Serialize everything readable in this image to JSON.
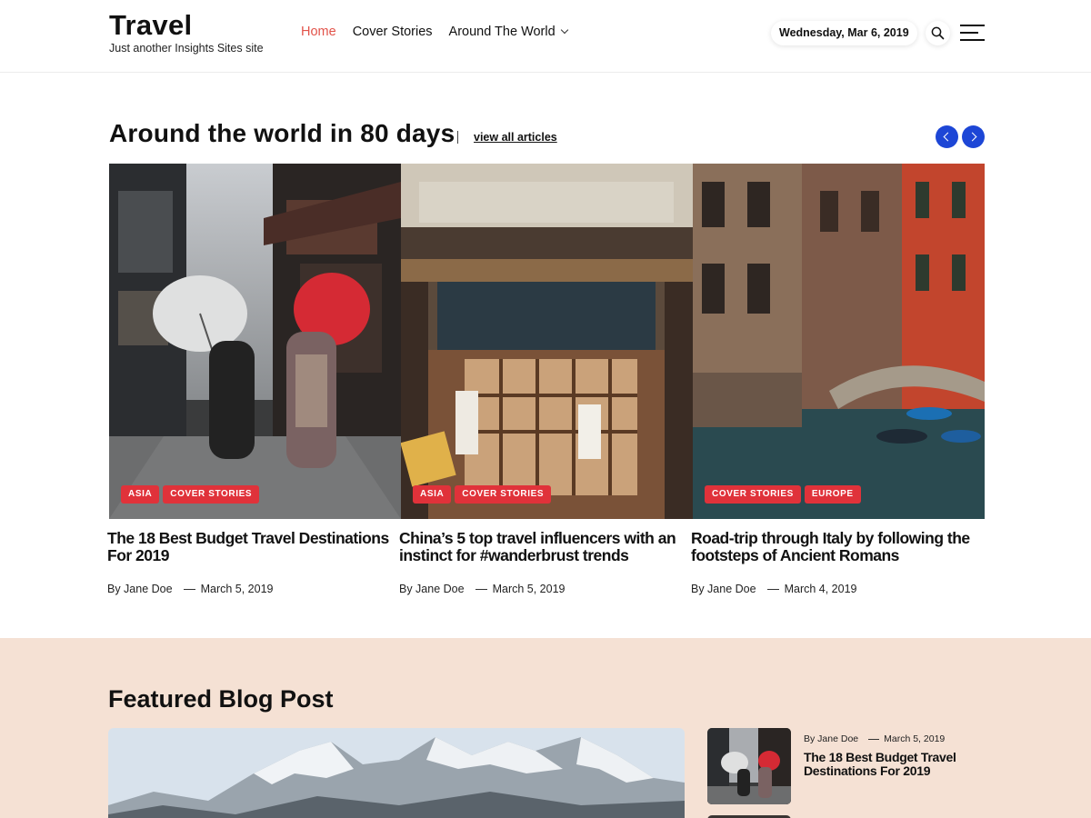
{
  "site": {
    "title": "Travel",
    "tagline": "Just another Insights Sites site"
  },
  "nav": {
    "items": [
      {
        "label": "Home",
        "active": true
      },
      {
        "label": "Cover Stories"
      },
      {
        "label": "Around The World",
        "has_dropdown": true
      }
    ]
  },
  "header": {
    "date": "Wednesday, Mar 6, 2019",
    "search_icon": "search-icon",
    "menu_icon": "hamburger-menu-icon"
  },
  "section": {
    "title": "Around the world in 80 days",
    "view_all": "view all articles"
  },
  "cards": [
    {
      "tags": [
        "ASIA",
        "COVER STORIES"
      ],
      "title": "The 18 Best Budget Travel Destinations For 2019",
      "author": "By Jane Doe",
      "date": "March 5, 2019",
      "image": "street with umbrellas"
    },
    {
      "tags": [
        "ASIA",
        "COVER STORIES"
      ],
      "title": "China’s 5 top travel influencers with an instinct for #wanderbrust trends",
      "author": "By Jane Doe",
      "date": "March 5, 2019",
      "image": "japanese restaurant storefront"
    },
    {
      "tags": [
        "COVER STORIES",
        "EUROPE"
      ],
      "title": "Road-trip through Italy by following the footsteps of Ancient Romans",
      "author": "By Jane Doe",
      "date": "March 4, 2019",
      "image": "venice canal"
    }
  ],
  "featured": {
    "title": "Featured Blog Post",
    "side_post": {
      "author": "By Jane Doe",
      "date": "March 5, 2019",
      "title": "The 18 Best Budget Travel Destinations For 2019"
    }
  },
  "colors": {
    "accent_nav": "#e2534a",
    "tag_bg": "#e0323a",
    "slider_button": "#1d46d6",
    "featured_bg": "#f5e1d4"
  }
}
